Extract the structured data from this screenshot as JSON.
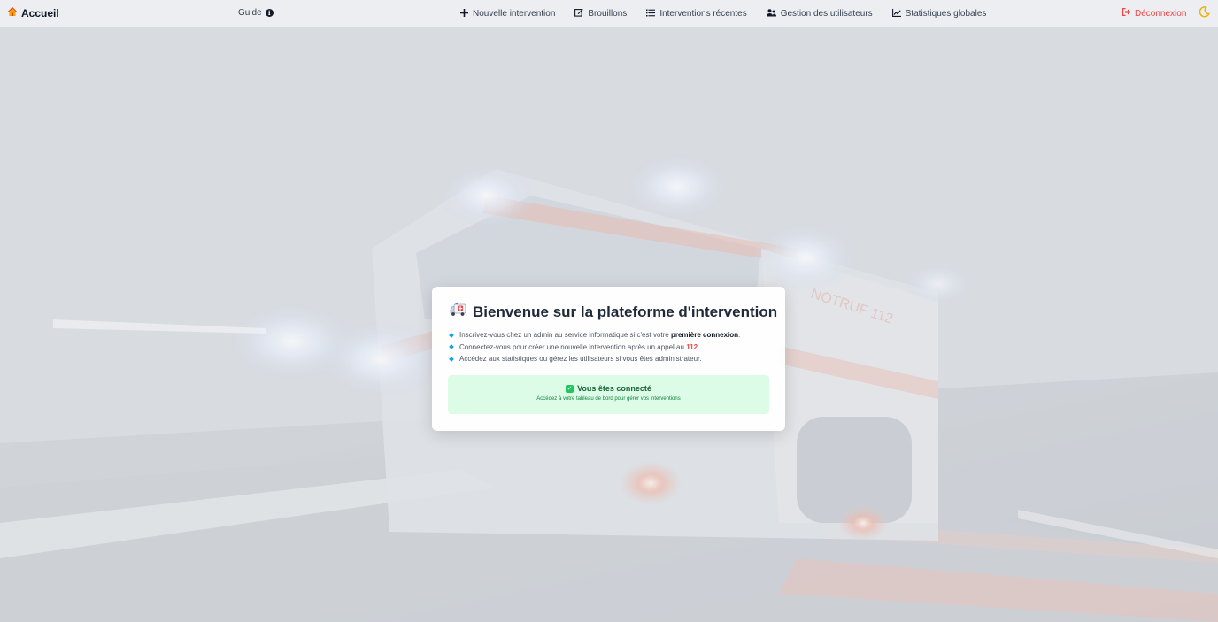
{
  "navbar": {
    "brand": "Accueil",
    "brand_icon": "house-icon",
    "guide": "Guide",
    "items": [
      {
        "label": "Nouvelle intervention",
        "icon": "plus-icon"
      },
      {
        "label": "Brouillons",
        "icon": "edit-icon"
      },
      {
        "label": "Interventions récentes",
        "icon": "list-icon"
      },
      {
        "label": "Gestion des utilisateurs",
        "icon": "users-icon"
      },
      {
        "label": "Statistiques globales",
        "icon": "chart-icon"
      }
    ],
    "logout": "Déconnexion",
    "theme_icon": "moon-icon"
  },
  "card": {
    "title": "Bienvenue sur la plateforme d'intervention",
    "title_icon": "ambulance-icon",
    "line1_pre": "Inscrivez-vous chez un admin au service informatique si c'est votre",
    "line1_bold": "première connexion",
    "line1_post": ".",
    "line2_pre": "Connectez-vous pour créer une nouvelle intervention après un appel au",
    "line2_bold": "112",
    "line2_post": ".",
    "line3": "Accédez aux statistiques ou gérez les utilisateurs si vous êtes administrateur.",
    "status_title": "Vous êtes connecté",
    "status_sub": "Accédez à votre tableau de bord pour gérer vos interventions"
  },
  "background": {
    "plate_text": "NOTRUF 112"
  },
  "colors": {
    "logout": "#ef4444",
    "accent_bullet": "#0ea5e9",
    "status_bg": "#dcfce7",
    "status_text": "#166534"
  }
}
